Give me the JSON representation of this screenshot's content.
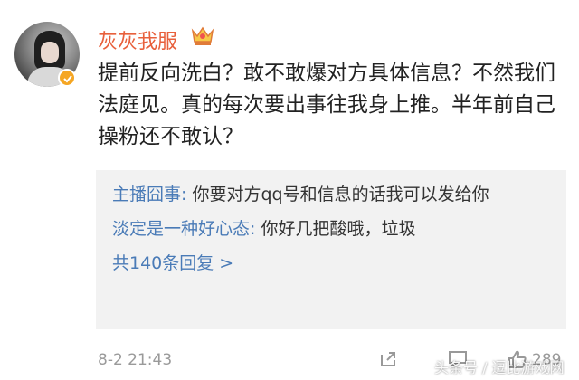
{
  "post": {
    "username": "灰灰我服",
    "text": "提前反向洗白？敢不敢爆对方具体信息？不然我们法庭见。真的每次要出事往我身上推。半年前自己操粉还不敢认？",
    "timestamp": "8-2 21:43",
    "like_count": "289"
  },
  "replies": [
    {
      "author": "主播囧事:",
      "text": " 你要对方qq号和信息的话我可以发给你"
    },
    {
      "author": "淡定是一种好心态:",
      "text": " 你好几把酸哦，垃圾"
    }
  ],
  "more_replies": "共140条回复 >",
  "watermark": "头条号 / 逗比游戏网",
  "icons": {
    "verified": "verified-badge-icon",
    "crown": "crown-vip-icon",
    "share": "share-icon",
    "comment": "comment-icon",
    "like": "like-icon"
  },
  "colors": {
    "username": "#e8603c",
    "link": "#4a7bb7",
    "reply_bg": "#f2f2f2"
  }
}
